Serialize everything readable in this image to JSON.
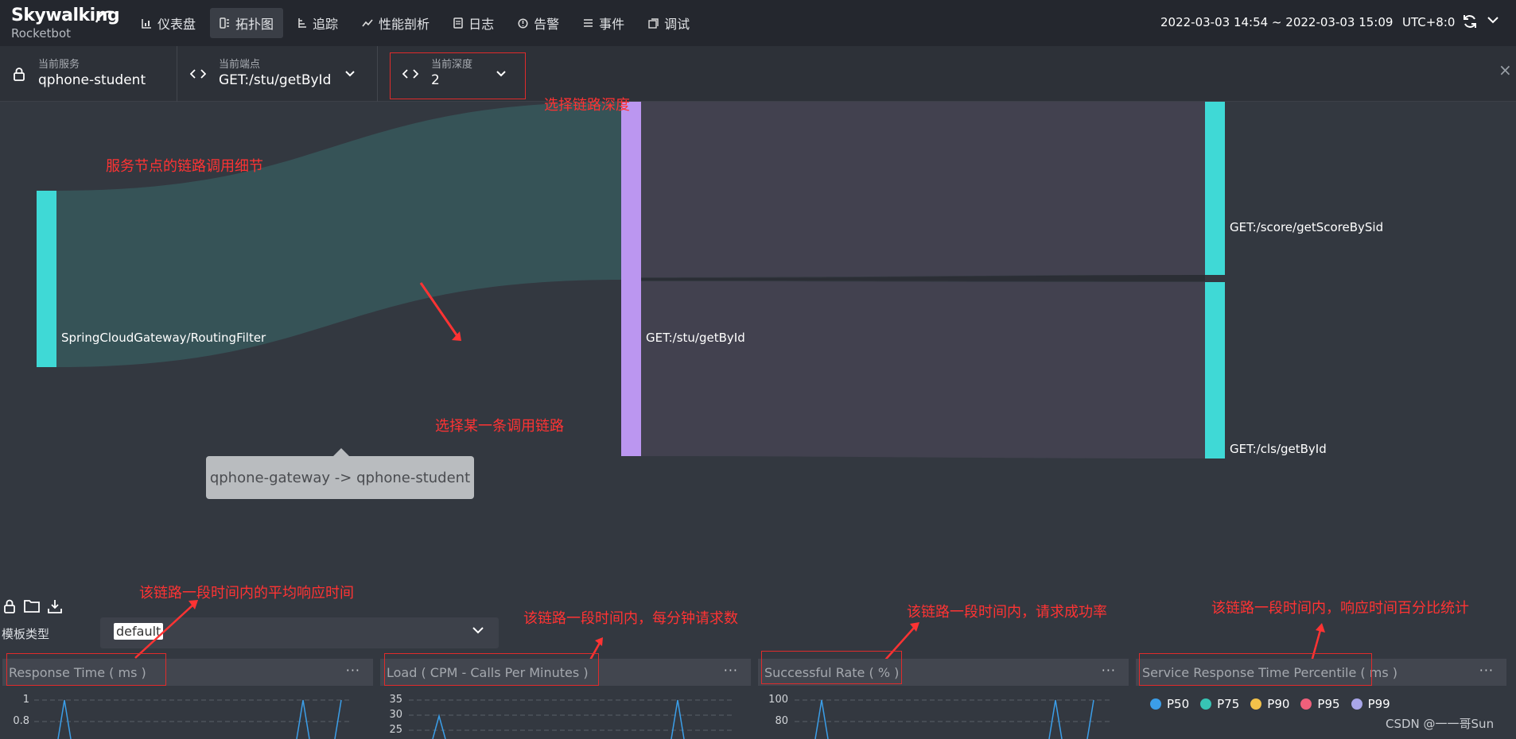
{
  "app": {
    "brand": "Skywalking",
    "sub_brand": "Rocketbot"
  },
  "nav": {
    "items": [
      {
        "label": "仪表盘",
        "icon": "chart-icon"
      },
      {
        "label": "拓扑图",
        "icon": "topology-icon",
        "active": true
      },
      {
        "label": "追踪",
        "icon": "trace-icon"
      },
      {
        "label": "性能剖析",
        "icon": "profile-icon"
      },
      {
        "label": "日志",
        "icon": "log-icon"
      },
      {
        "label": "告警",
        "icon": "alarm-icon"
      },
      {
        "label": "事件",
        "icon": "event-icon"
      },
      {
        "label": "调试",
        "icon": "debug-icon"
      }
    ],
    "time_range": "2022-03-03 14:54 ~ 2022-03-03 15:09",
    "timezone": "UTC+8:0"
  },
  "selectors": {
    "service": {
      "label": "当前服务",
      "value": "qphone-student"
    },
    "endpoint": {
      "label": "当前端点",
      "value": "GET:/stu/getById"
    },
    "depth": {
      "label": "当前深度",
      "value": "2"
    }
  },
  "sankey": {
    "nodes": {
      "gateway": "SpringCloudGateway/RoutingFilter",
      "center": "GET:/stu/getById",
      "score": "GET:/score/getScoreBySid",
      "cls": "GET:/cls/getById"
    },
    "tooltip": "qphone-gateway -> qphone-student"
  },
  "annotations": {
    "depth": "选择链路深度",
    "node_detail": "服务节点的链路调用细节",
    "select_link": "选择某一条调用链路",
    "avg_response": "该链路一段时间内的平均响应时间",
    "cpm": "该链路一段时间内，每分钟请求数",
    "success_rate": "该链路一段时间内，请求成功率",
    "percentile": "该链路一段时间内，响应时间百分比统计"
  },
  "template": {
    "label": "模板类型",
    "value": "default"
  },
  "panels": [
    {
      "title": "Response Time ( ms )",
      "ticks": [
        "1",
        "0.8"
      ]
    },
    {
      "title": "Load ( CPM - Calls Per Minutes )",
      "ticks": [
        "35",
        "30",
        "25"
      ]
    },
    {
      "title": "Successful Rate ( % )",
      "ticks": [
        "100",
        "80"
      ]
    },
    {
      "title": "Service Response Time Percentile ( ms )",
      "ticks": []
    }
  ],
  "legend": [
    {
      "label": "P50",
      "color": "#3b9ee8"
    },
    {
      "label": "P75",
      "color": "#37c4b4"
    },
    {
      "label": "P90",
      "color": "#f3c24a"
    },
    {
      "label": "P95",
      "color": "#f0607b"
    },
    {
      "label": "P99",
      "color": "#a9a6e9"
    }
  ],
  "watermark": "CSDN @一一哥Sun"
}
